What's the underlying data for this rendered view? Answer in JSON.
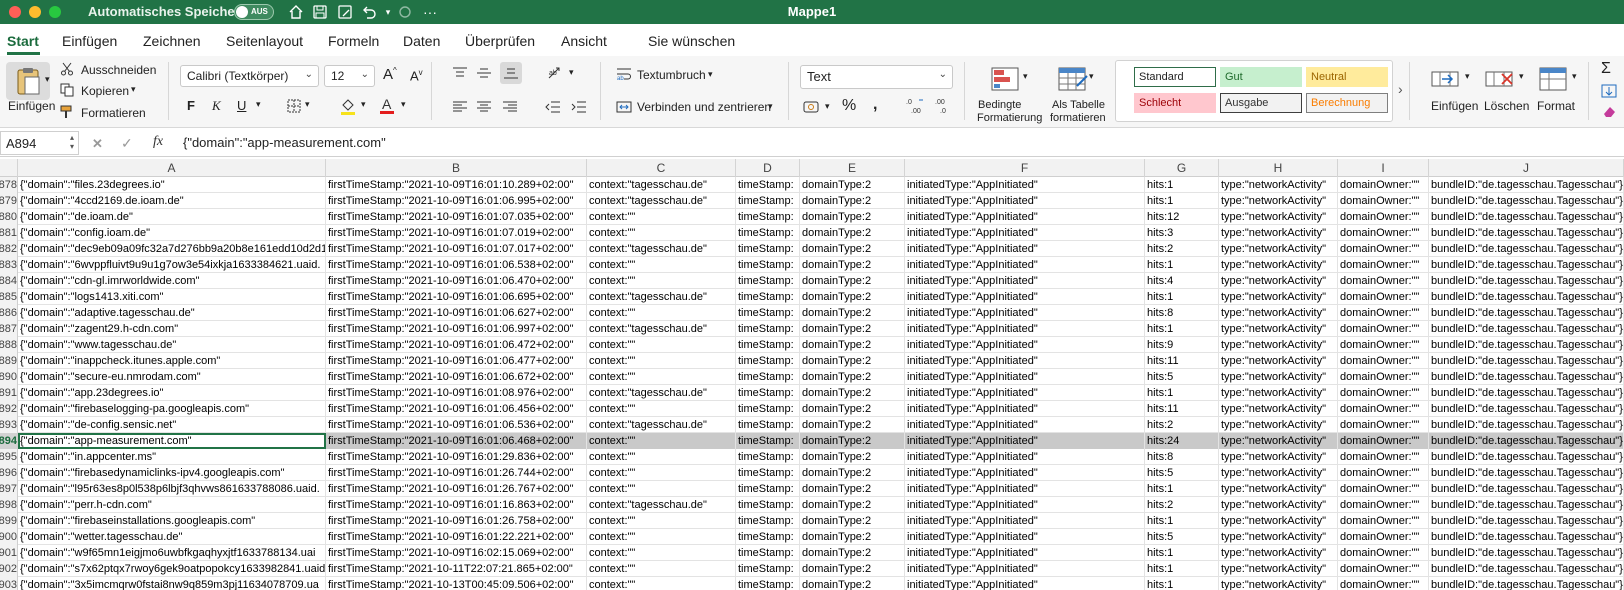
{
  "titlebar": {
    "autosave_label": "Automatisches Speichern",
    "autosave_state": "AUS",
    "doc_title": "Mappe1"
  },
  "tabs": [
    "Start",
    "Einfügen",
    "Zeichnen",
    "Seitenlayout",
    "Formeln",
    "Daten",
    "Überprüfen",
    "Ansicht",
    "Sie wünschen"
  ],
  "ribbon": {
    "paste_label": "Einfügen",
    "cut_label": "Ausschneiden",
    "copy_label": "Kopieren",
    "format_painter_label": "Formatieren",
    "font_name": "Calibri (Textkörper)",
    "font_size": "12",
    "wrap_text_label": "Textumbruch",
    "merge_center_label": "Verbinden und zentrieren",
    "number_format": "Text",
    "conditional_format_label_1": "Bedingte",
    "conditional_format_label_2": "Formatierung",
    "format_as_table_label_1": "Als Tabelle",
    "format_as_table_label_2": "formatieren",
    "styles": {
      "standard": "Standard",
      "gut": "Gut",
      "neutral": "Neutral",
      "schlecht": "Schlecht",
      "ausgabe": "Ausgabe",
      "berechnung": "Berechnung"
    },
    "insert_cells_label": "Einfügen",
    "delete_cells_label": "Löschen",
    "format_cells_label": "Format",
    "bold": "F",
    "italic": "K",
    "underline": "U",
    "fx": "fx"
  },
  "formula_bar": {
    "name_box": "A894",
    "formula": "{\"domain\":\"app-measurement.com\""
  },
  "columns": [
    "A",
    "B",
    "C",
    "D",
    "E",
    "F",
    "G",
    "H",
    "I",
    "J"
  ],
  "rows": [
    {
      "n": "878",
      "a": "{\"domain\":\"files.23degrees.io\"",
      "b": "firstTimeStamp:\"2021-10-09T16:01:10.289+02:00\"",
      "c": "context:\"tagesschau.de\"",
      "d": "timeStamp:",
      "e": "domainType:2",
      "f": "initiatedType:\"AppInitiated\"",
      "g": "hits:1",
      "h": "type:\"networkActivity\"",
      "i": "domainOwner:\"\"",
      "j": "bundleID:\"de.tagesschau.Tagesschau\"}"
    },
    {
      "n": "879",
      "a": "{\"domain\":\"4ccd2169.de.ioam.de\"",
      "b": "firstTimeStamp:\"2021-10-09T16:01:06.995+02:00\"",
      "c": "context:\"tagesschau.de\"",
      "d": "timeStamp:",
      "e": "domainType:2",
      "f": "initiatedType:\"AppInitiated\"",
      "g": "hits:1",
      "h": "type:\"networkActivity\"",
      "i": "domainOwner:\"\"",
      "j": "bundleID:\"de.tagesschau.Tagesschau\"}"
    },
    {
      "n": "880",
      "a": "{\"domain\":\"de.ioam.de\"",
      "b": "firstTimeStamp:\"2021-10-09T16:01:07.035+02:00\"",
      "c": "context:\"\"",
      "d": "timeStamp:",
      "e": "domainType:2",
      "f": "initiatedType:\"AppInitiated\"",
      "g": "hits:12",
      "h": "type:\"networkActivity\"",
      "i": "domainOwner:\"\"",
      "j": "bundleID:\"de.tagesschau.Tagesschau\"}"
    },
    {
      "n": "881",
      "a": "{\"domain\":\"config.ioam.de\"",
      "b": "firstTimeStamp:\"2021-10-09T16:01:07.019+02:00\"",
      "c": "context:\"\"",
      "d": "timeStamp:",
      "e": "domainType:2",
      "f": "initiatedType:\"AppInitiated\"",
      "g": "hits:3",
      "h": "type:\"networkActivity\"",
      "i": "domainOwner:\"\"",
      "j": "bundleID:\"de.tagesschau.Tagesschau\"}"
    },
    {
      "n": "882",
      "a": "{\"domain\":\"dec9eb09a09fc32a7d276bb9a20b8e161edd10d2d1",
      "b": "firstTimeStamp:\"2021-10-09T16:01:07.017+02:00\"",
      "c": "context:\"tagesschau.de\"",
      "d": "timeStamp:",
      "e": "domainType:2",
      "f": "initiatedType:\"AppInitiated\"",
      "g": "hits:2",
      "h": "type:\"networkActivity\"",
      "i": "domainOwner:\"\"",
      "j": "bundleID:\"de.tagesschau.Tagesschau\"}"
    },
    {
      "n": "883",
      "a": "{\"domain\":\"6wvppfluivt9u9u1g7ow3e54ixkja1633384621.uaid.",
      "b": "firstTimeStamp:\"2021-10-09T16:01:06.538+02:00\"",
      "c": "context:\"\"",
      "d": "timeStamp:",
      "e": "domainType:2",
      "f": "initiatedType:\"AppInitiated\"",
      "g": "hits:1",
      "h": "type:\"networkActivity\"",
      "i": "domainOwner:\"\"",
      "j": "bundleID:\"de.tagesschau.Tagesschau\"}"
    },
    {
      "n": "884",
      "a": "{\"domain\":\"cdn-gl.imrworldwide.com\"",
      "b": "firstTimeStamp:\"2021-10-09T16:01:06.470+02:00\"",
      "c": "context:\"\"",
      "d": "timeStamp:",
      "e": "domainType:2",
      "f": "initiatedType:\"AppInitiated\"",
      "g": "hits:4",
      "h": "type:\"networkActivity\"",
      "i": "domainOwner:\"\"",
      "j": "bundleID:\"de.tagesschau.Tagesschau\"}"
    },
    {
      "n": "885",
      "a": "{\"domain\":\"logs1413.xiti.com\"",
      "b": "firstTimeStamp:\"2021-10-09T16:01:06.695+02:00\"",
      "c": "context:\"tagesschau.de\"",
      "d": "timeStamp:",
      "e": "domainType:2",
      "f": "initiatedType:\"AppInitiated\"",
      "g": "hits:1",
      "h": "type:\"networkActivity\"",
      "i": "domainOwner:\"\"",
      "j": "bundleID:\"de.tagesschau.Tagesschau\"}"
    },
    {
      "n": "886",
      "a": "{\"domain\":\"adaptive.tagesschau.de\"",
      "b": "firstTimeStamp:\"2021-10-09T16:01:06.627+02:00\"",
      "c": "context:\"\"",
      "d": "timeStamp:",
      "e": "domainType:2",
      "f": "initiatedType:\"AppInitiated\"",
      "g": "hits:8",
      "h": "type:\"networkActivity\"",
      "i": "domainOwner:\"\"",
      "j": "bundleID:\"de.tagesschau.Tagesschau\"}"
    },
    {
      "n": "887",
      "a": "{\"domain\":\"zagent29.h-cdn.com\"",
      "b": "firstTimeStamp:\"2021-10-09T16:01:06.997+02:00\"",
      "c": "context:\"tagesschau.de\"",
      "d": "timeStamp:",
      "e": "domainType:2",
      "f": "initiatedType:\"AppInitiated\"",
      "g": "hits:1",
      "h": "type:\"networkActivity\"",
      "i": "domainOwner:\"\"",
      "j": "bundleID:\"de.tagesschau.Tagesschau\"}"
    },
    {
      "n": "888",
      "a": "{\"domain\":\"www.tagesschau.de\"",
      "b": "firstTimeStamp:\"2021-10-09T16:01:06.472+02:00\"",
      "c": "context:\"\"",
      "d": "timeStamp:",
      "e": "domainType:2",
      "f": "initiatedType:\"AppInitiated\"",
      "g": "hits:9",
      "h": "type:\"networkActivity\"",
      "i": "domainOwner:\"\"",
      "j": "bundleID:\"de.tagesschau.Tagesschau\"}"
    },
    {
      "n": "889",
      "a": "{\"domain\":\"inappcheck.itunes.apple.com\"",
      "b": "firstTimeStamp:\"2021-10-09T16:01:06.477+02:00\"",
      "c": "context:\"\"",
      "d": "timeStamp:",
      "e": "domainType:2",
      "f": "initiatedType:\"AppInitiated\"",
      "g": "hits:11",
      "h": "type:\"networkActivity\"",
      "i": "domainOwner:\"\"",
      "j": "bundleID:\"de.tagesschau.Tagesschau\"}"
    },
    {
      "n": "890",
      "a": "{\"domain\":\"secure-eu.nmrodam.com\"",
      "b": "firstTimeStamp:\"2021-10-09T16:01:06.672+02:00\"",
      "c": "context:\"\"",
      "d": "timeStamp:",
      "e": "domainType:2",
      "f": "initiatedType:\"AppInitiated\"",
      "g": "hits:5",
      "h": "type:\"networkActivity\"",
      "i": "domainOwner:\"\"",
      "j": "bundleID:\"de.tagesschau.Tagesschau\"}"
    },
    {
      "n": "891",
      "a": "{\"domain\":\"app.23degrees.io\"",
      "b": "firstTimeStamp:\"2021-10-09T16:01:08.976+02:00\"",
      "c": "context:\"tagesschau.de\"",
      "d": "timeStamp:",
      "e": "domainType:2",
      "f": "initiatedType:\"AppInitiated\"",
      "g": "hits:1",
      "h": "type:\"networkActivity\"",
      "i": "domainOwner:\"\"",
      "j": "bundleID:\"de.tagesschau.Tagesschau\"}"
    },
    {
      "n": "892",
      "a": "{\"domain\":\"firebaselogging-pa.googleapis.com\"",
      "b": "firstTimeStamp:\"2021-10-09T16:01:06.456+02:00\"",
      "c": "context:\"\"",
      "d": "timeStamp:",
      "e": "domainType:2",
      "f": "initiatedType:\"AppInitiated\"",
      "g": "hits:11",
      "h": "type:\"networkActivity\"",
      "i": "domainOwner:\"\"",
      "j": "bundleID:\"de.tagesschau.Tagesschau\"}"
    },
    {
      "n": "893",
      "a": "{\"domain\":\"de-config.sensic.net\"",
      "b": "firstTimeStamp:\"2021-10-09T16:01:06.536+02:00\"",
      "c": "context:\"tagesschau.de\"",
      "d": "timeStamp:",
      "e": "domainType:2",
      "f": "initiatedType:\"AppInitiated\"",
      "g": "hits:2",
      "h": "type:\"networkActivity\"",
      "i": "domainOwner:\"\"",
      "j": "bundleID:\"de.tagesschau.Tagesschau\"}"
    },
    {
      "n": "894",
      "selected": true,
      "a": "{\"domain\":\"app-measurement.com\"",
      "b": "firstTimeStamp:\"2021-10-09T16:01:06.468+02:00\"",
      "c": "context:\"\"",
      "d": "timeStamp:",
      "e": "domainType:2",
      "f": "initiatedType:\"AppInitiated\"",
      "g": "hits:24",
      "h": "type:\"networkActivity\"",
      "i": "domainOwner:\"\"",
      "j": "bundleID:\"de.tagesschau.Tagesschau\"}"
    },
    {
      "n": "895",
      "a": "{\"domain\":\"in.appcenter.ms\"",
      "b": "firstTimeStamp:\"2021-10-09T16:01:29.836+02:00\"",
      "c": "context:\"\"",
      "d": "timeStamp:",
      "e": "domainType:2",
      "f": "initiatedType:\"AppInitiated\"",
      "g": "hits:8",
      "h": "type:\"networkActivity\"",
      "i": "domainOwner:\"\"",
      "j": "bundleID:\"de.tagesschau.Tagesschau\"}"
    },
    {
      "n": "896",
      "a": "{\"domain\":\"firebasedynamiclinks-ipv4.googleapis.com\"",
      "b": "firstTimeStamp:\"2021-10-09T16:01:26.744+02:00\"",
      "c": "context:\"\"",
      "d": "timeStamp:",
      "e": "domainType:2",
      "f": "initiatedType:\"AppInitiated\"",
      "g": "hits:5",
      "h": "type:\"networkActivity\"",
      "i": "domainOwner:\"\"",
      "j": "bundleID:\"de.tagesschau.Tagesschau\"}"
    },
    {
      "n": "897",
      "a": "{\"domain\":\"l95r63es8p0l538p6lbjf3qhvws861633788086.uaid.",
      "b": "firstTimeStamp:\"2021-10-09T16:01:26.767+02:00\"",
      "c": "context:\"\"",
      "d": "timeStamp:",
      "e": "domainType:2",
      "f": "initiatedType:\"AppInitiated\"",
      "g": "hits:1",
      "h": "type:\"networkActivity\"",
      "i": "domainOwner:\"\"",
      "j": "bundleID:\"de.tagesschau.Tagesschau\"}"
    },
    {
      "n": "898",
      "a": "{\"domain\":\"perr.h-cdn.com\"",
      "b": "firstTimeStamp:\"2021-10-09T16:01:16.863+02:00\"",
      "c": "context:\"tagesschau.de\"",
      "d": "timeStamp:",
      "e": "domainType:2",
      "f": "initiatedType:\"AppInitiated\"",
      "g": "hits:2",
      "h": "type:\"networkActivity\"",
      "i": "domainOwner:\"\"",
      "j": "bundleID:\"de.tagesschau.Tagesschau\"}"
    },
    {
      "n": "899",
      "a": "{\"domain\":\"firebaseinstallations.googleapis.com\"",
      "b": "firstTimeStamp:\"2021-10-09T16:01:26.758+02:00\"",
      "c": "context:\"\"",
      "d": "timeStamp:",
      "e": "domainType:2",
      "f": "initiatedType:\"AppInitiated\"",
      "g": "hits:1",
      "h": "type:\"networkActivity\"",
      "i": "domainOwner:\"\"",
      "j": "bundleID:\"de.tagesschau.Tagesschau\"}"
    },
    {
      "n": "900",
      "a": "{\"domain\":\"wetter.tagesschau.de\"",
      "b": "firstTimeStamp:\"2021-10-09T16:01:22.221+02:00\"",
      "c": "context:\"\"",
      "d": "timeStamp:",
      "e": "domainType:2",
      "f": "initiatedType:\"AppInitiated\"",
      "g": "hits:5",
      "h": "type:\"networkActivity\"",
      "i": "domainOwner:\"\"",
      "j": "bundleID:\"de.tagesschau.Tagesschau\"}"
    },
    {
      "n": "901",
      "a": "{\"domain\":\"w9f65mn1eigjmo6uwbfkgaqhyxjtf1633788134.uai",
      "b": "firstTimeStamp:\"2021-10-09T16:02:15.069+02:00\"",
      "c": "context:\"\"",
      "d": "timeStamp:",
      "e": "domainType:2",
      "f": "initiatedType:\"AppInitiated\"",
      "g": "hits:1",
      "h": "type:\"networkActivity\"",
      "i": "domainOwner:\"\"",
      "j": "bundleID:\"de.tagesschau.Tagesschau\"}"
    },
    {
      "n": "902",
      "a": "{\"domain\":\"s7x62ptqx7rwoy6gek9oatpopokcy1633982841.uaid",
      "b": "firstTimeStamp:\"2021-10-11T22:07:21.865+02:00\"",
      "c": "context:\"\"",
      "d": "timeStamp:",
      "e": "domainType:2",
      "f": "initiatedType:\"AppInitiated\"",
      "g": "hits:1",
      "h": "type:\"networkActivity\"",
      "i": "domainOwner:\"\"",
      "j": "bundleID:\"de.tagesschau.Tagesschau\"}"
    },
    {
      "n": "903",
      "a": "{\"domain\":\"3x5imcmqrw0fstai8nw9q859m3pj11634078709.ua",
      "b": "firstTimeStamp:\"2021-10-13T00:45:09.506+02:00\"",
      "c": "context:\"\"",
      "d": "timeStamp:",
      "e": "domainType:2",
      "f": "initiatedType:\"AppInitiated\"",
      "g": "hits:1",
      "h": "type:\"networkActivity\"",
      "i": "domainOwner:\"\"",
      "j": "bundleID:\"de.tagesschau.Tagesschau\"}"
    }
  ]
}
